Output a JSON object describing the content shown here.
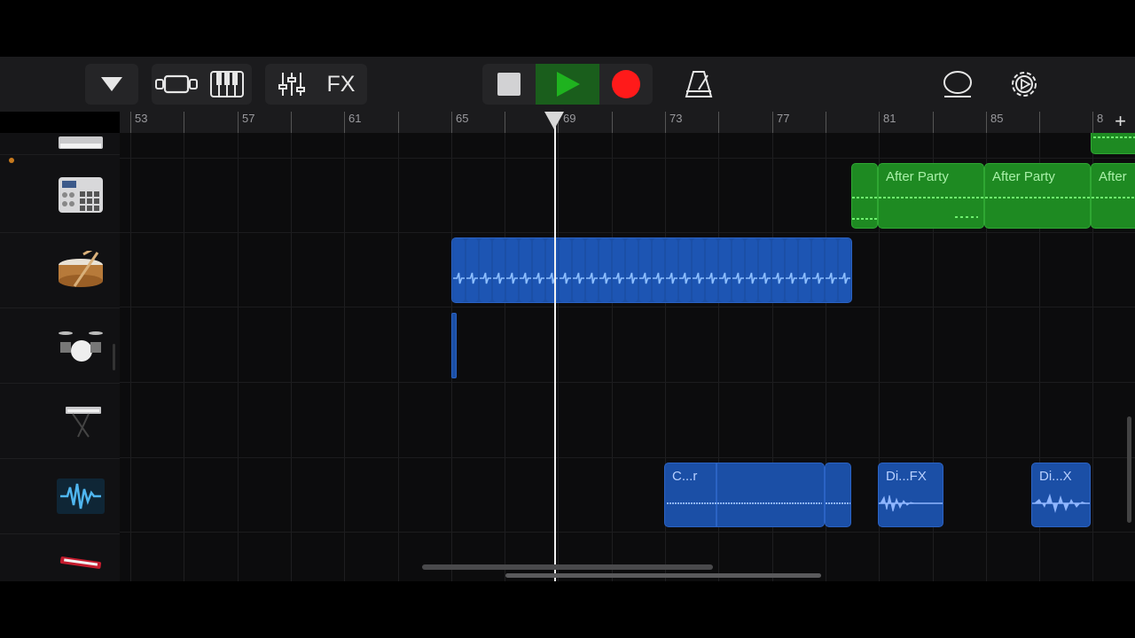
{
  "toolbar": {
    "fx_label": "FX",
    "play_color": "#1fb31f",
    "record_color": "#ff1a1a"
  },
  "ruler": {
    "bar_numbers": [
      "53",
      "57",
      "61",
      "65",
      "69",
      "73",
      "77",
      "81",
      "85",
      "8"
    ],
    "add_track_symbol": "+"
  },
  "tracks": [
    {
      "instrument": "keyboard-synth-icon"
    },
    {
      "instrument": "beat-sequencer-icon"
    },
    {
      "instrument": "snare-drum-icon"
    },
    {
      "instrument": "drum-kit-icon"
    },
    {
      "instrument": "keyboard-stand-icon"
    },
    {
      "instrument": "audio-waveform-icon"
    },
    {
      "instrument": "red-keyboard-icon"
    }
  ],
  "regions": {
    "after_party": [
      "After Party",
      "After Party",
      "After"
    ],
    "c_region": "C...r",
    "di_fx_1": "Di...FX",
    "di_fx_2": "Di...X"
  }
}
